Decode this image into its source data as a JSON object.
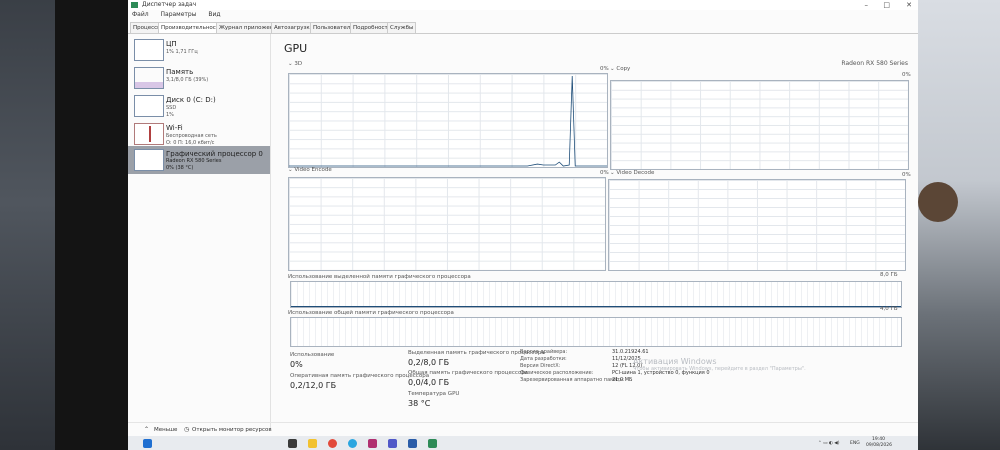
{
  "window": {
    "title": "Диспетчер задач"
  },
  "menu": [
    "Файл",
    "Параметры",
    "Вид"
  ],
  "tabs": [
    "Процессы",
    "Производительность",
    "Журнал приложений",
    "Автозагрузка",
    "Пользователи",
    "Подробности",
    "Службы"
  ],
  "sidebar": {
    "items": [
      {
        "name": "ЦП",
        "sub1": "1% 1,71 ГГц",
        "sub2": ""
      },
      {
        "name": "Память",
        "sub1": "3,1/8,0 ГБ (39%)",
        "sub2": ""
      },
      {
        "name": "Диск 0 (C: D:)",
        "sub1": "SSD",
        "sub2": "1%"
      },
      {
        "name": "Wi-Fi",
        "sub1": "Беспроводная сеть",
        "sub2": "О: 0 П: 16,0 кбит/с"
      },
      {
        "name": "Графический процессор 0",
        "sub1": "Radeon RX 580 Series",
        "sub2": "0% (38 °C)"
      }
    ]
  },
  "main": {
    "title": "GPU",
    "gpu_name": "Radeon RX 580 Series",
    "graphs": [
      {
        "label": "3D",
        "value": "0%"
      },
      {
        "label": "Copy",
        "value": "0%"
      },
      {
        "label": "Video Encode",
        "value": "0%"
      },
      {
        "label": "Video Decode",
        "value": "0%"
      }
    ],
    "dedicated_graph_label": "Использование выделенной памяти графического процессора",
    "dedicated_graph_max": "8,0 ГБ",
    "shared_graph_label": "Использование общей памяти графического процессора",
    "shared_graph_max": "4,0 ГБ",
    "stats": {
      "usage_label": "Использование",
      "usage_value": "0%",
      "gpu_mem_label": "Оперативная память графического процессора",
      "gpu_mem_value": "0,2/12,0 ГБ",
      "dedicated_label": "Выделенная память графического процессора",
      "dedicated_value": "0,2/8,0 ГБ",
      "shared_label": "Общая память графического процессора",
      "shared_value": "0,0/4,0 ГБ",
      "temp_label": "Температура GPU",
      "temp_value": "38 °C"
    },
    "details": [
      {
        "key": "Версия драйвера:",
        "value": "31.0.21924.61"
      },
      {
        "key": "Дата разработки:",
        "value": "11/12/2025"
      },
      {
        "key": "Версия DirectX:",
        "value": "12 (FL 12.0)"
      },
      {
        "key": "Физическое расположение:",
        "value": "PCI-шина 1, устройство 0, функция 0"
      },
      {
        "key": "Зарезервированная аппаратно память:",
        "value": "21,0 МБ"
      }
    ]
  },
  "activation": {
    "title": "Активация Windows",
    "text": "Чтобы активировать Windows, перейдите в раздел \"Параметры\"."
  },
  "bottom": {
    "less_label": "Меньше",
    "monitor_label": "Открыть монитор ресурсов"
  },
  "tray": {
    "lang": "ENG",
    "time": "19:40",
    "date": "09/08/2026"
  },
  "colors": {
    "accent": "#1f4e79",
    "graph_border": "#a9b3bf",
    "selected_item": "#9ba0a8"
  }
}
